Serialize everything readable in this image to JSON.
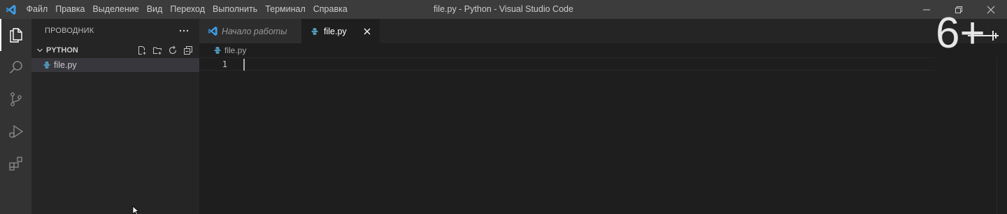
{
  "titlebar": {
    "menu": [
      "Файл",
      "Правка",
      "Выделение",
      "Вид",
      "Переход",
      "Выполнить",
      "Терминал",
      "Справка"
    ],
    "title": "file.py - Python - Visual Studio Code",
    "controls": [
      "minimize-icon",
      "restore-icon",
      "close-icon"
    ]
  },
  "activitybar": {
    "items": [
      "explorer-icon",
      "search-icon",
      "source-control-icon",
      "run-debug-icon",
      "extensions-icon"
    ],
    "active": "explorer-icon"
  },
  "sidebar": {
    "title": "ПРОВОДНИК",
    "folder": "PYTHON",
    "folder_actions": [
      "new-file-icon",
      "new-folder-icon",
      "refresh-icon",
      "collapse-all-icon"
    ],
    "files": [
      {
        "name": "file.py",
        "icon": "python-file-icon",
        "selected": true
      }
    ]
  },
  "editor": {
    "tabs": [
      {
        "label": "Начало работы",
        "icon": "vscode-logo-icon",
        "active": false
      },
      {
        "label": "file.py",
        "icon": "python-file-icon",
        "active": true
      }
    ],
    "breadcrumb": "file.py",
    "lines": [
      {
        "number": "1",
        "text": ""
      }
    ]
  },
  "watermark": {
    "text": "6+"
  },
  "colors": {
    "titlebar": "#3c3c3c",
    "activitybar": "#333333",
    "sidebar": "#252526",
    "editor": "#1e1e1e",
    "accent": "#007acc",
    "python": "#519aba"
  }
}
